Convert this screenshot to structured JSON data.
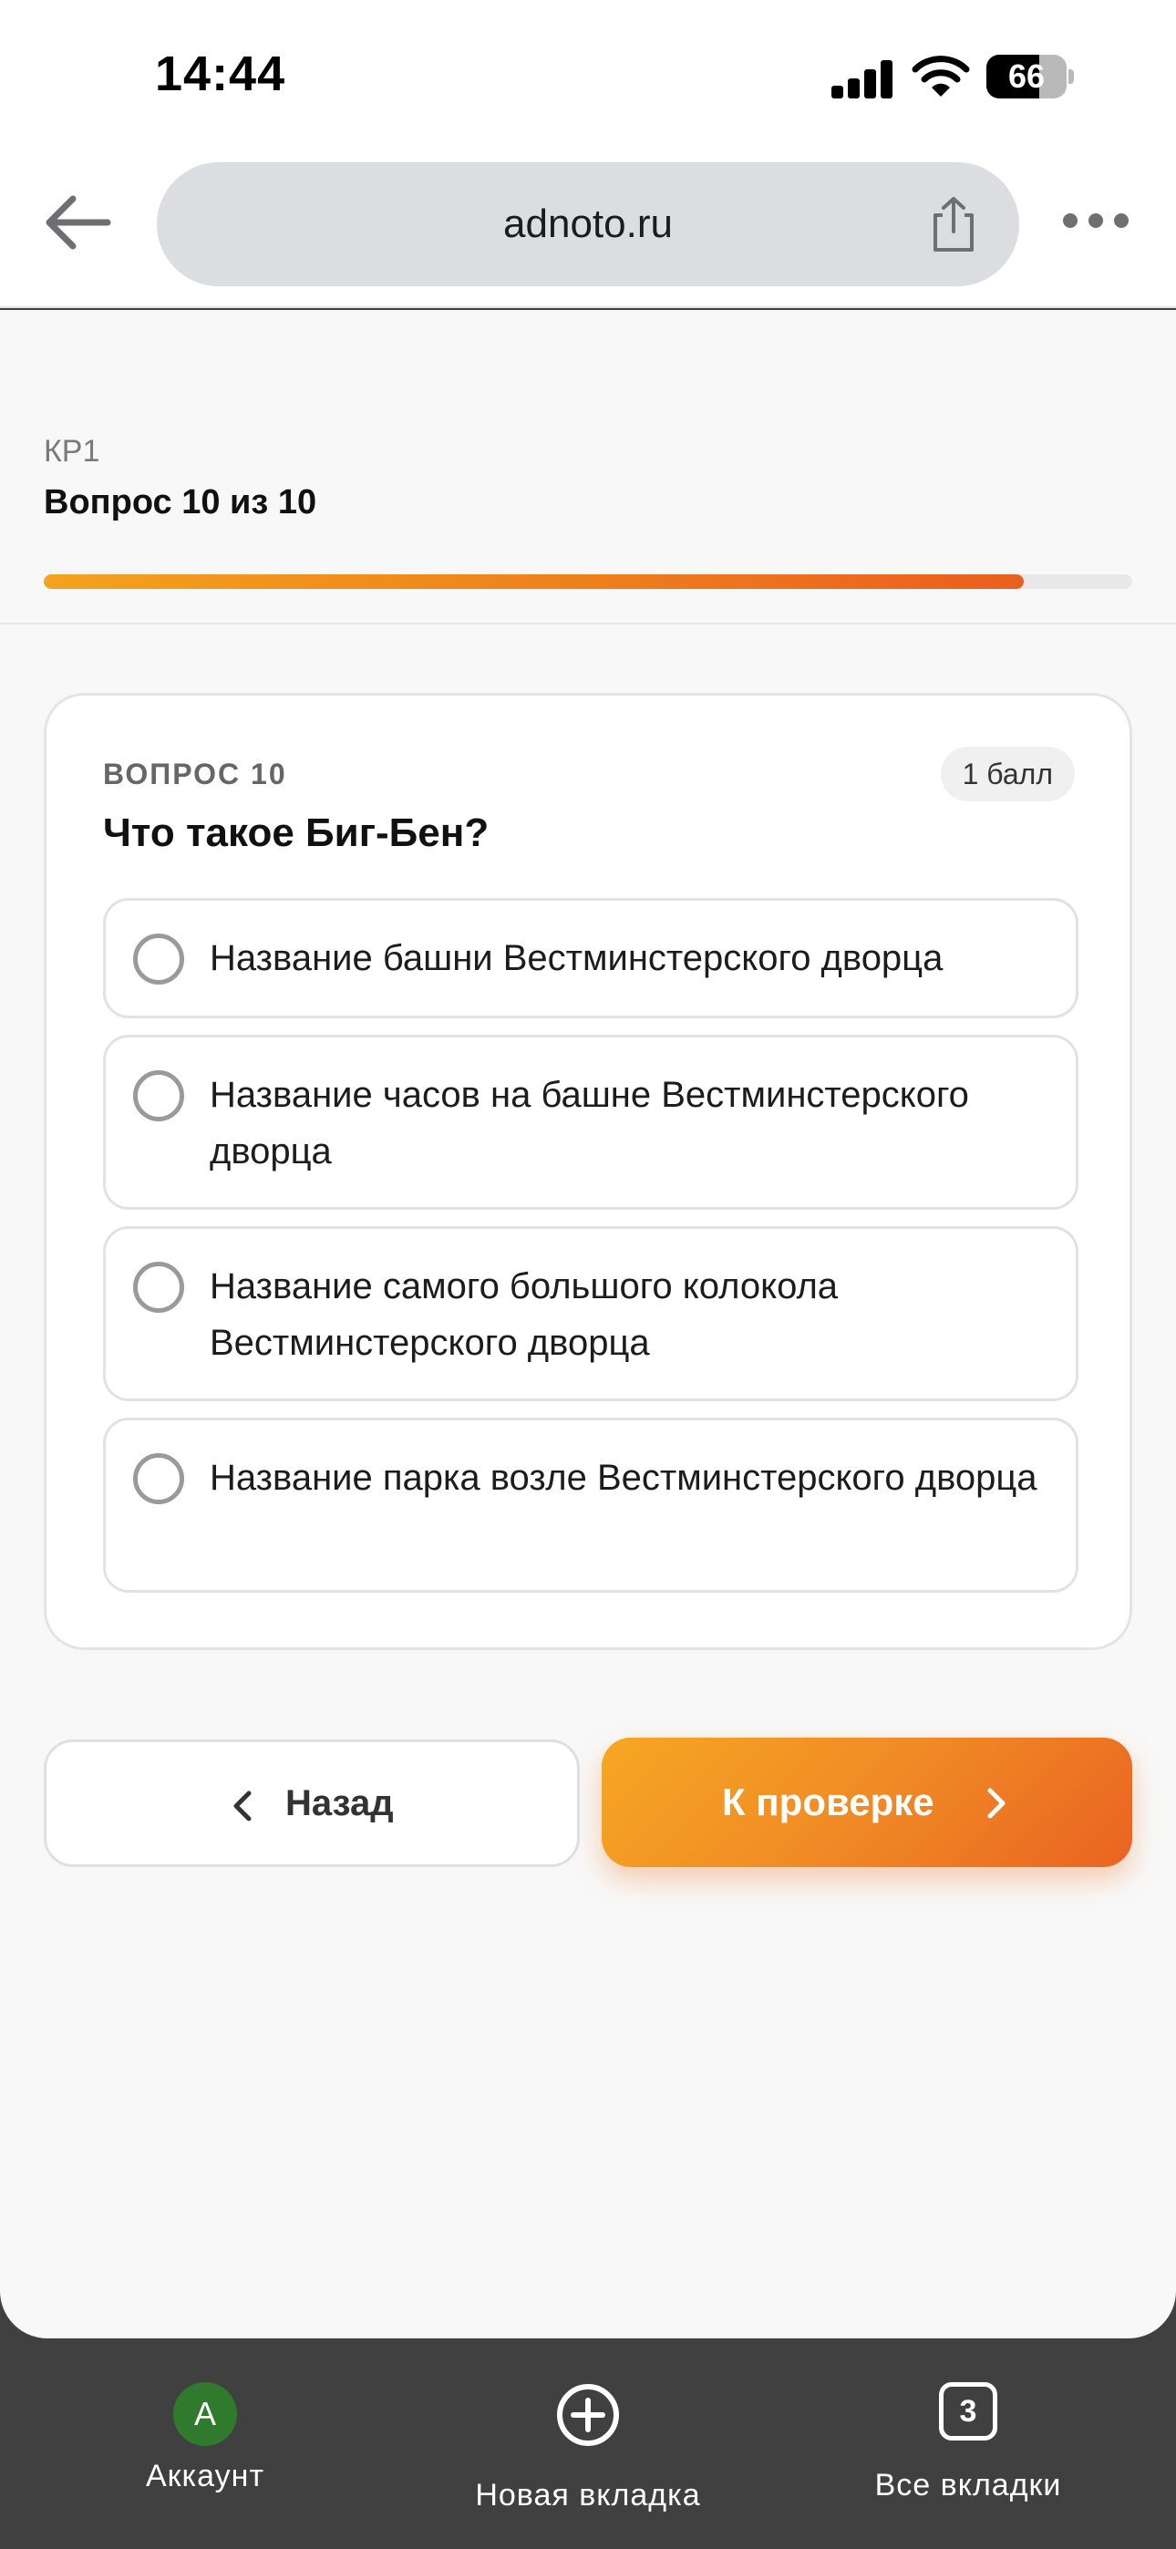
{
  "status_bar": {
    "time": "14:44",
    "battery_level": "66",
    "battery_fraction": 0.66
  },
  "browser": {
    "url": "adnoto.ru"
  },
  "quiz": {
    "code": "КР1",
    "progress_label": "Вопрос 10 из 10",
    "progress_fraction": 0.9
  },
  "question": {
    "number_label": "ВОПРОС 10",
    "points": "1 балл",
    "text": "Что такое Биг-Бен?",
    "options": [
      {
        "text": "Название башни Вестминстерского дворца",
        "selected": false
      },
      {
        "text": "Название часов на башне Вестминстерского дворца",
        "selected": false
      },
      {
        "text": "Название самого большого колокола Вестминстерского дворца",
        "selected": false
      },
      {
        "text": "Название парка возле Вестминстерского дворца",
        "selected": false
      }
    ]
  },
  "navigation": {
    "back_label": "Назад",
    "next_label": "К проверке"
  },
  "bottom_bar": {
    "account_initial": "А",
    "account_label": "Аккаунт",
    "new_tab_label": "Новая вкладка",
    "tabs_count": "3",
    "all_tabs_label": "Все вкладки"
  },
  "colors": {
    "accent_start": "#f4a21f",
    "accent_end": "#ea5f1d",
    "avatar_green": "#2f7a2c"
  }
}
